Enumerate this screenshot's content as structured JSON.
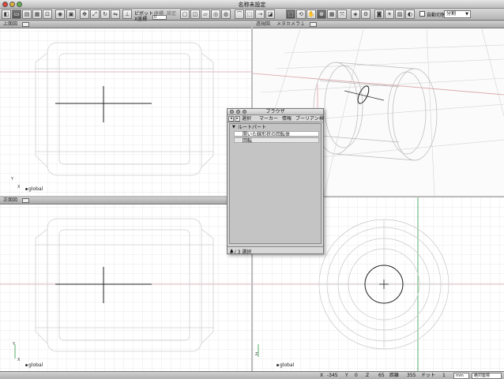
{
  "window": {
    "title": "名称未設定"
  },
  "toolbar": {
    "pivot_label": "ピボット",
    "pivot_sub1": "座標",
    "pivot_sub2": "設定",
    "coord_label": "X座標",
    "coord_value": "0",
    "auto_switch_label": "自動切替",
    "split_value": "分割"
  },
  "viewports": {
    "top": {
      "label": "上面図"
    },
    "persp": {
      "label": "透視図",
      "camera": "メタカメラ１"
    },
    "front": {
      "label": "正面図"
    },
    "global_tag": "global",
    "axis_x": "X",
    "axis_y": "Y",
    "axis_z": "Z"
  },
  "browser": {
    "title": "ブラウザ",
    "menus": [
      "選択",
      "マーカー",
      "情報",
      "ブーリアン",
      "検"
    ],
    "root": "ルートパート",
    "items": [
      "開いた線形状の回転体",
      "回転"
    ],
    "footer": "1 / 3 選択"
  },
  "status": {
    "x_label": "X",
    "x_value": "-345",
    "y_label": "Y",
    "y_value": "0",
    "z_label": "Z",
    "z_value": "65",
    "dist_label": "距離",
    "dist_value": "355",
    "dot_label": "ドット",
    "dot_value": "1",
    "unit_value": "mm",
    "mode_value": "絶対座標"
  },
  "colors": {
    "viewport_bg": "#ffffff",
    "grid": "#e4e4e4",
    "axis_red": "#c9313c",
    "axis_green": "#2f9a43"
  }
}
